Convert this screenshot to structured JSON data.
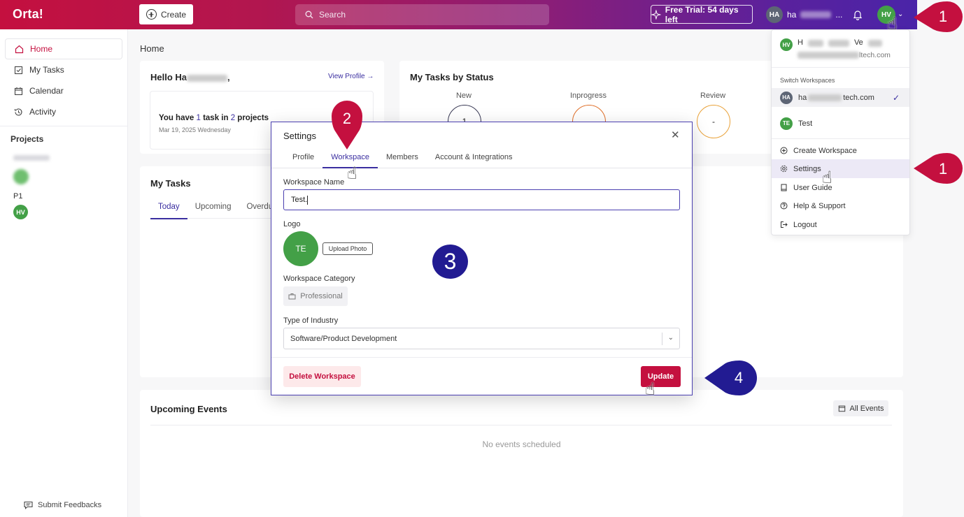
{
  "app": {
    "logo": "Orta!"
  },
  "topbar": {
    "create_label": "Create",
    "search_placeholder": "Search",
    "trial_label": "Free Trial: 54 days left",
    "user_initials": "HA",
    "user_name_prefix": "ha",
    "user_name_suffix": "...",
    "profile_initials": "HV"
  },
  "sidebar": {
    "items": [
      {
        "label": "Home",
        "icon": "home-icon"
      },
      {
        "label": "My Tasks",
        "icon": "checkbox-icon"
      },
      {
        "label": "Calendar",
        "icon": "calendar-icon"
      },
      {
        "label": "Activity",
        "icon": "history-icon"
      }
    ],
    "projects_heading": "Projects",
    "project_p1": "P1",
    "project_p1_initials": "HV",
    "feedback_label": "Submit Feedbacks"
  },
  "main": {
    "page_title": "Home",
    "hello": "Hello Ha",
    "hello_suffix": ",",
    "view_profile": "View Profile →",
    "task_summary_pre": "You have ",
    "task_count": "1",
    "task_summary_mid": " task in ",
    "project_count": "2",
    "task_summary_post": " projects",
    "task_date": "Mar 19, 2025 Wednesday",
    "status_title": "My Tasks by Status",
    "statuses": [
      {
        "label": "New",
        "value": "1"
      },
      {
        "label": "Inprogress",
        "value": ""
      },
      {
        "label": "Review",
        "value": "-"
      }
    ],
    "mytasks_title": "My Tasks",
    "mytasks_tabs": [
      "Today",
      "Upcoming",
      "Overdu"
    ],
    "events_title": "Upcoming Events",
    "all_events": "All Events",
    "no_events": "No events scheduled"
  },
  "dropdown": {
    "user_initials": "HV",
    "user_name_a": "H",
    "user_name_b": "Ve",
    "user_email_suffix": "ltech.com",
    "switch_heading": "Switch Workspaces",
    "workspaces": [
      {
        "initials": "HA",
        "name_prefix": "ha",
        "name_suffix": "tech.com",
        "selected": true
      },
      {
        "initials": "TE",
        "name": "Test",
        "selected": false
      }
    ],
    "actions": [
      {
        "label": "Create Workspace",
        "icon": "plus-circle-icon"
      },
      {
        "label": "Settings",
        "icon": "gear-icon"
      },
      {
        "label": "User Guide",
        "icon": "book-icon"
      },
      {
        "label": "Help & Support",
        "icon": "help-icon"
      },
      {
        "label": "Logout",
        "icon": "logout-icon"
      }
    ]
  },
  "modal": {
    "title": "Settings",
    "tabs": [
      "Profile",
      "Workspace",
      "Members",
      "Account & Integrations"
    ],
    "active_tab": "Workspace",
    "name_label": "Workspace Name",
    "name_value": "Test.",
    "logo_label": "Logo",
    "logo_initials": "TE",
    "upload_label": "Upload Photo",
    "category_label": "Workspace Category",
    "category_value": "Professional",
    "industry_label": "Type of Industry",
    "industry_value": "Software/Product Development",
    "delete_label": "Delete Workspace",
    "update_label": "Update"
  },
  "annotations": {
    "step1": "1",
    "step2": "2",
    "step3": "3",
    "step4": "4"
  },
  "colors": {
    "brand_red": "#c4103f",
    "brand_purple": "#4a24a8",
    "accent_indigo": "#3a2ea0",
    "marker_red": "#c4103f",
    "marker_navy": "#221b92",
    "avatar_green": "#43a047"
  }
}
